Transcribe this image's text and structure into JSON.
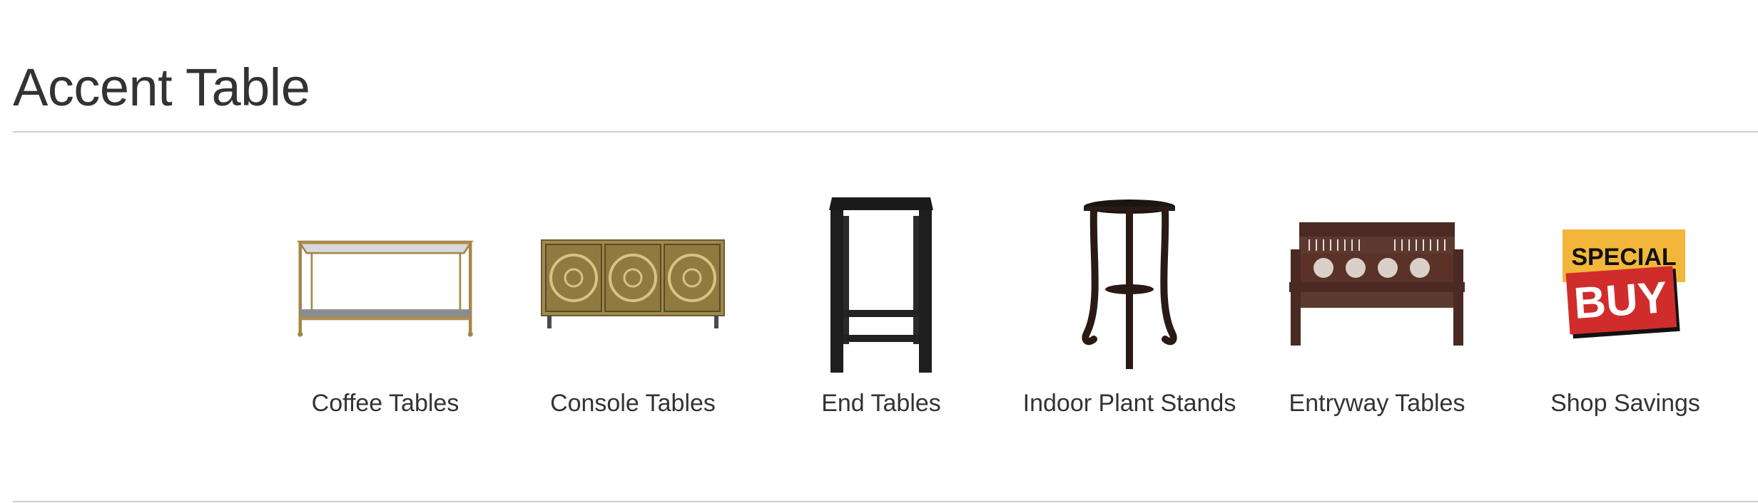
{
  "page": {
    "title": "Accent Table"
  },
  "categories": [
    {
      "label": "Coffee Tables",
      "icon": "coffee-table-image"
    },
    {
      "label": "Console Tables",
      "icon": "console-table-image"
    },
    {
      "label": "End Tables",
      "icon": "end-table-image"
    },
    {
      "label": "Indoor Plant Stands",
      "icon": "plant-stand-image"
    },
    {
      "label": "Entryway Tables",
      "icon": "entryway-bench-image"
    },
    {
      "label": "Shop Savings",
      "icon": "special-buy-badge"
    }
  ],
  "badge": {
    "top_text": "SPECIAL",
    "bottom_text": "BUY",
    "top_color": "#f2b73a",
    "bottom_color": "#d12c2c"
  }
}
